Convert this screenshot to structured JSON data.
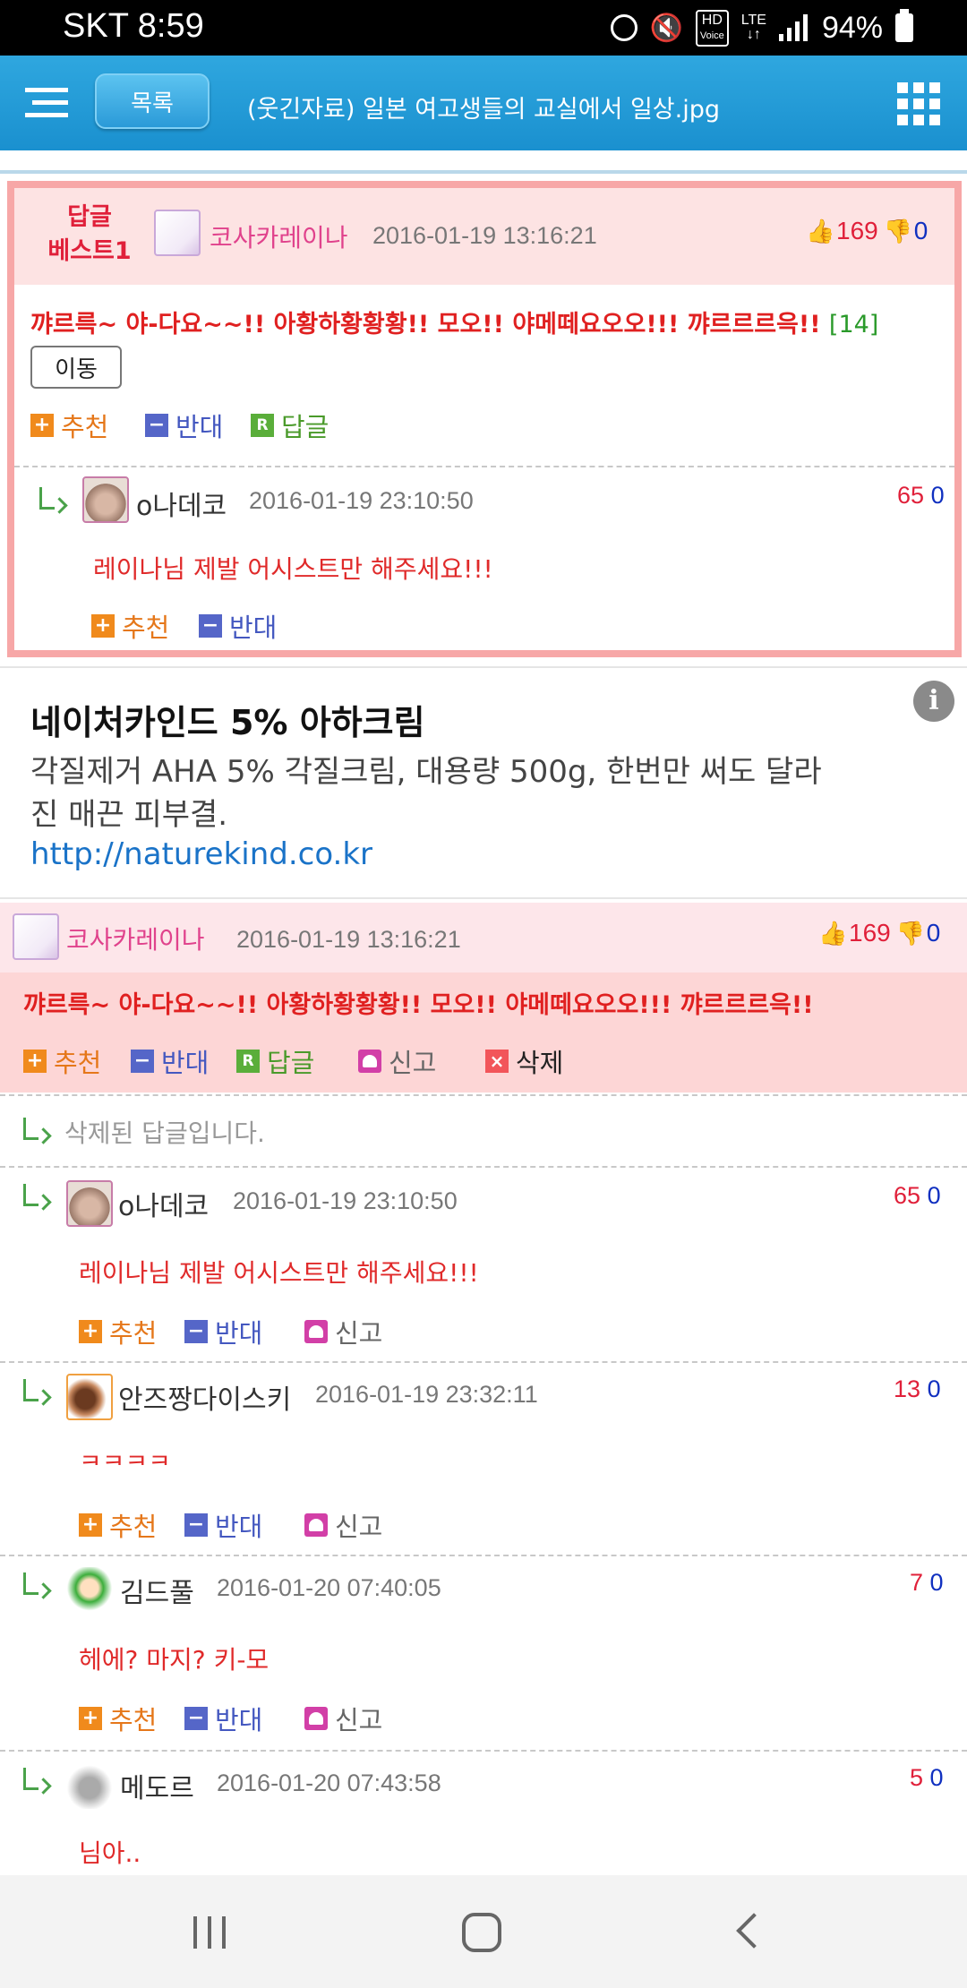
{
  "status_bar": {
    "carrier_time": "SKT 8:59",
    "hd": "HD",
    "voice": "Voice",
    "lte": "LTE",
    "battery": "94%"
  },
  "header": {
    "list_button": "목록",
    "title": "(웃긴자료) 일본 여고생들의 교실에서 일상.jpg"
  },
  "best": {
    "label_line1": "답글",
    "label_line2": "베스트1",
    "author": "코사카레이나",
    "date": "2016-01-19 13:16:21",
    "up": "169",
    "down": "0",
    "text": "꺄르륵~ 야-다요~~!! 아황하황황황!! 모오!! 야메떼요오오!!! 꺄르르르윽!! ",
    "reply_count": "[14]",
    "move_button": "이동",
    "actions": {
      "recommend": "추천",
      "oppose": "반대",
      "reply": "답글"
    },
    "reply": {
      "author": "o나데코",
      "date": "2016-01-19 23:10:50",
      "up": "65",
      "down": "0",
      "text": "레이나님 제발 어시스트만 해주세요!!!",
      "recommend": "추천",
      "oppose": "반대"
    }
  },
  "ad": {
    "title": "네이처카인드 5% 아하크림",
    "description": "각질제거 AHA 5% 각질크림, 대용량 500g, 한번만 써도 달라진 매끈 피부결.",
    "link": "http://naturekind.co.kr"
  },
  "main_comment": {
    "author": "코사카레이나",
    "date": "2016-01-19 13:16:21",
    "up": "169",
    "down": "0",
    "text": "꺄르륵~ 야-다요~~!! 아황하황황황!! 모오!! 야메떼요오오!!! 꺄르르르윽!!",
    "actions": {
      "recommend": "추천",
      "oppose": "반대",
      "reply": "답글",
      "report": "신고",
      "delete": "삭제"
    }
  },
  "deleted_reply": "삭제된 답글입니다.",
  "replies": [
    {
      "author": "o나데코",
      "date": "2016-01-19 23:10:50",
      "up": "65",
      "down": "0",
      "text": "레이나님 제발 어시스트만 해주세요!!!",
      "recommend": "추천",
      "oppose": "반대",
      "report": "신고"
    },
    {
      "author": "안즈짱다이스키",
      "date": "2016-01-19 23:32:11",
      "up": "13",
      "down": "0",
      "text": "ㅋㅋㅋㅋ",
      "recommend": "추천",
      "oppose": "반대",
      "report": "신고"
    },
    {
      "author": "김드풀",
      "date": "2016-01-20 07:40:05",
      "up": "7",
      "down": "0",
      "text": "헤에? 마지? 키-모",
      "recommend": "추천",
      "oppose": "반대",
      "report": "신고"
    },
    {
      "author": "메도르",
      "date": "2016-01-20 07:43:58",
      "up": "5",
      "down": "0",
      "text": "님아.."
    }
  ]
}
